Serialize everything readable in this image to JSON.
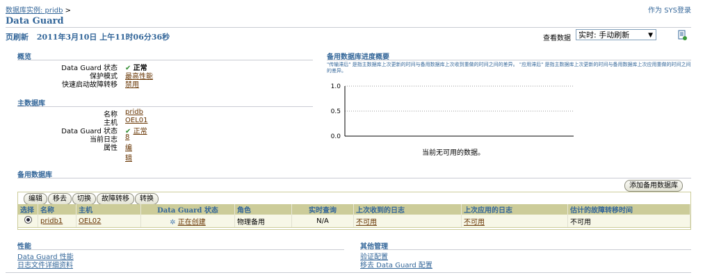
{
  "breadcrumb": {
    "link": "数据库实例: pridb",
    "sep": ">"
  },
  "user": {
    "prefix": "作为",
    "name": "SYS",
    "action": "登录"
  },
  "page_title": "Data Guard",
  "refresh": {
    "label": "页刷新",
    "time": "2011年3月10日 上午11时06分36秒"
  },
  "view_data": {
    "label": "查看数据",
    "selected": "实时: 手动刷新"
  },
  "overview": {
    "heading": "概览",
    "rows": [
      {
        "k": "Data Guard 状态",
        "v": "正常"
      },
      {
        "k": "保护模式",
        "v": "最高性能"
      },
      {
        "k": "快速启动故障转移",
        "v": "禁用"
      }
    ]
  },
  "primary": {
    "heading": "主数据库",
    "rows": [
      {
        "k": "名称",
        "v": "pridb"
      },
      {
        "k": "主机",
        "v": "OEL01"
      },
      {
        "k": "Data Guard 状态",
        "v": "正常"
      },
      {
        "k": "当前日志",
        "v": "8"
      },
      {
        "k": "属性",
        "v": "编辑"
      }
    ]
  },
  "progress": {
    "heading": "备用数据库进度概要",
    "note": "\"传输滞后\" 是指主数据库上次更新的时间与备用数据库上次收到重做的时间之间的差异。 \"应用滞后\" 是指主数据库上次更新的时间与备用数据库上次应用重做的时间之间的差异。",
    "empty_msg": "当前无可用的数据。"
  },
  "chart_data": {
    "type": "line",
    "series": [],
    "yticks": [
      "1.0",
      "0.5",
      "0.0"
    ],
    "ylim": [
      0,
      1
    ],
    "grid": true
  },
  "standby": {
    "heading": "备用数据库",
    "buttons": [
      "编辑",
      "移去",
      "切换",
      "故障转移",
      "转换"
    ],
    "add_button": "添加备用数据库",
    "columns": [
      "选择",
      "名称",
      "主机",
      "Data Guard 状态",
      "角色",
      "实时查询",
      "上次收到的日志",
      "上次应用的日志",
      "估计的故障转移时间"
    ],
    "rows": [
      {
        "name": "pridb1",
        "host": "OEL02",
        "status": "正在创建",
        "role": "物理备用",
        "rtq": "N/A",
        "recv": "不可用",
        "applied": "不可用",
        "eta": "不可用"
      }
    ]
  },
  "performance": {
    "heading": "性能",
    "links": [
      "Data Guard 性能",
      "日志文件详细资料"
    ]
  },
  "other": {
    "heading": "其他管理",
    "links": [
      "验证配置",
      "移去 Data Guard 配置"
    ]
  }
}
